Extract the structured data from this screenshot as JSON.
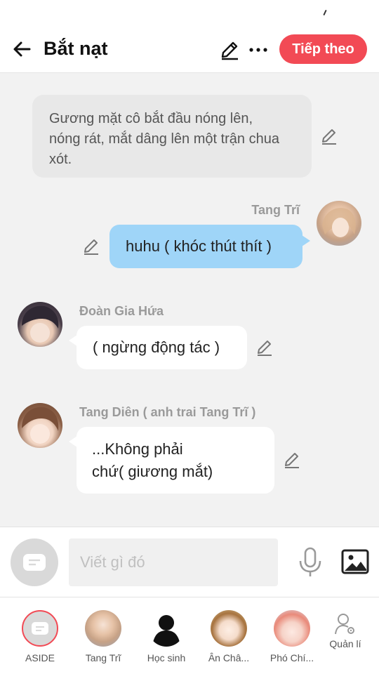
{
  "header": {
    "title": "Bắt nạt",
    "next_label": "Tiếp theo"
  },
  "messages": [
    {
      "type": "narration",
      "text_lines": [
        "Gương mặt cô bắt đầu nóng lên,",
        "nóng rát, mắt dâng lên một trận chua",
        "xót."
      ]
    },
    {
      "type": "right",
      "speaker": "Tang Trĩ",
      "text": "huhu ( khóc thút thít )"
    },
    {
      "type": "left",
      "speaker": "Đoàn Gia Hứa",
      "text": "( ngừng động tác )"
    },
    {
      "type": "left",
      "speaker": "Tang Diên ( anh trai Tang Trĩ )",
      "text_lines": [
        "...Không phải",
        "chứ( giương mắt)"
      ]
    }
  ],
  "composer": {
    "placeholder": "Viết gì đó"
  },
  "characters": [
    {
      "label": "ASIDE"
    },
    {
      "label": "Tang Trĩ"
    },
    {
      "label": "Học sinh"
    },
    {
      "label": "Ân Châ..."
    },
    {
      "label": "Phó Chí..."
    },
    {
      "label": "Quản lí"
    }
  ],
  "colors": {
    "accent": "#f24a55",
    "own_bubble": "#9fd5f8",
    "background": "#f2f2f2"
  }
}
